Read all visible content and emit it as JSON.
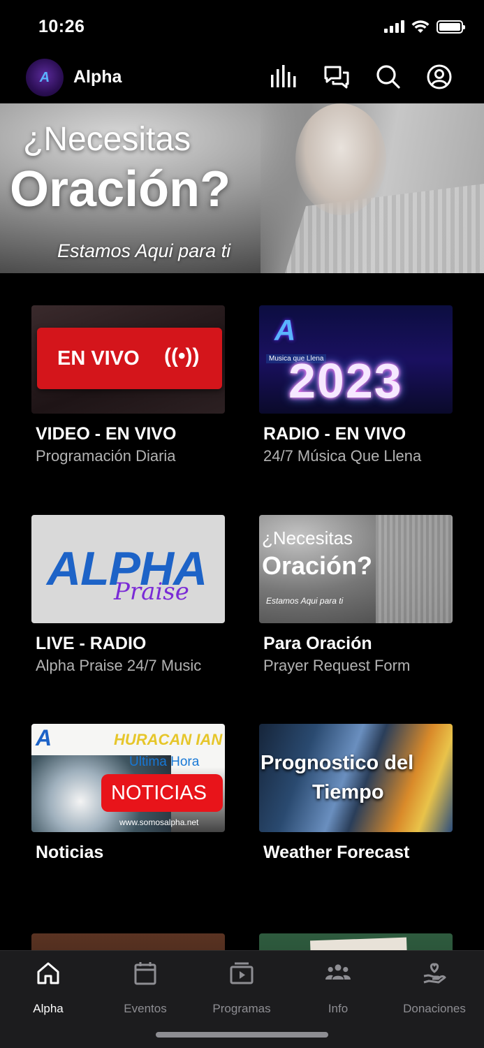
{
  "status_bar": {
    "time": "10:26"
  },
  "header": {
    "title": "Alpha",
    "logo_letter": "A"
  },
  "hero": {
    "line1": "¿Necesitas",
    "line2": "Oración?",
    "line3": "Estamos Aqui para ti"
  },
  "cards": [
    {
      "title": "VIDEO - EN VIVO",
      "subtitle": "Programación Diaria",
      "thumb_text": "EN VIVO",
      "thumb_symbol": "((•))"
    },
    {
      "title": "RADIO - EN VIVO",
      "subtitle": "24/7 Música Que Llena",
      "thumb_text": "2023",
      "thumb_tag": "Musica que Llena",
      "thumb_letter": "A"
    },
    {
      "title": "LIVE - RADIO",
      "subtitle": "Alpha Praise 24/7 Music",
      "thumb_text": "ALPHA",
      "thumb_text2": "Praise"
    },
    {
      "title": "Para Oración",
      "subtitle": "Prayer Request Form",
      "thumb_text": "¿Necesitas",
      "thumb_text2": "Oración?",
      "thumb_text3": "Estamos Aqui para ti"
    },
    {
      "title": "Noticias",
      "subtitle": "",
      "thumb_text": "HURACAN IAN",
      "thumb_text2": "Ultima Hora",
      "thumb_text3": "NOTICIAS",
      "thumb_url": "www.somosalpha.net",
      "thumb_letter": "A"
    },
    {
      "title": "Weather Forecast",
      "subtitle": "",
      "thumb_text": "Prognostico del",
      "thumb_text2": "Tiempo"
    }
  ],
  "tabs": [
    {
      "label": "Alpha",
      "icon": "home-icon",
      "active": true
    },
    {
      "label": "Eventos",
      "icon": "calendar-icon",
      "active": false
    },
    {
      "label": "Programas",
      "icon": "video-playlist-icon",
      "active": false
    },
    {
      "label": "Info",
      "icon": "people-icon",
      "active": false
    },
    {
      "label": "Donaciones",
      "icon": "donate-hand-icon",
      "active": false
    }
  ]
}
